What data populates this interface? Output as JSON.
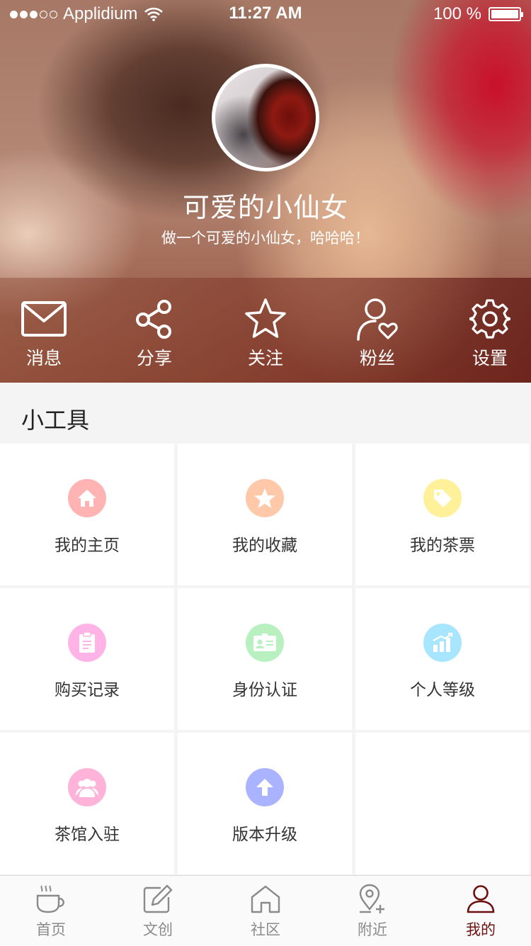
{
  "status_bar": {
    "carrier": "Applidium",
    "time": "11:27 AM",
    "battery": "100 %"
  },
  "profile": {
    "name": "可爱的小仙女",
    "bio": "做一个可爱的小仙女，哈哈哈！"
  },
  "actions": [
    {
      "label": "消息",
      "icon": "mail-icon"
    },
    {
      "label": "分享",
      "icon": "share-icon"
    },
    {
      "label": "关注",
      "icon": "star-icon"
    },
    {
      "label": "粉丝",
      "icon": "follower-heart-icon"
    },
    {
      "label": "设置",
      "icon": "gear-icon"
    }
  ],
  "tools": {
    "title": "小工具",
    "items": [
      {
        "label": "我的主页",
        "icon": "home-icon",
        "color": "#ffb3b3"
      },
      {
        "label": "我的收藏",
        "icon": "star-icon",
        "color": "#ffc8a8"
      },
      {
        "label": "我的茶票",
        "icon": "tag-icon",
        "color": "#fff09a"
      },
      {
        "label": "购买记录",
        "icon": "clipboard-icon",
        "color": "#ffb3e6"
      },
      {
        "label": "身份认证",
        "icon": "id-card-icon",
        "color": "#b8f0c0"
      },
      {
        "label": "个人等级",
        "icon": "chart-icon",
        "color": "#a8e6ff"
      },
      {
        "label": "茶馆入驻",
        "icon": "people-icon",
        "color": "#ffb3d9"
      },
      {
        "label": "版本升级",
        "icon": "upload-arrow-icon",
        "color": "#aab3ff"
      }
    ]
  },
  "tabs": [
    {
      "label": "首页",
      "icon": "tea-cup-icon",
      "active": false
    },
    {
      "label": "文创",
      "icon": "edit-icon",
      "active": false
    },
    {
      "label": "社区",
      "icon": "house-icon",
      "active": false
    },
    {
      "label": "附近",
      "icon": "location-add-icon",
      "active": false
    },
    {
      "label": "我的",
      "icon": "user-icon",
      "active": true
    }
  ],
  "colors": {
    "active_tab": "#6e1010",
    "inactive_tab": "#8a8a8a"
  }
}
